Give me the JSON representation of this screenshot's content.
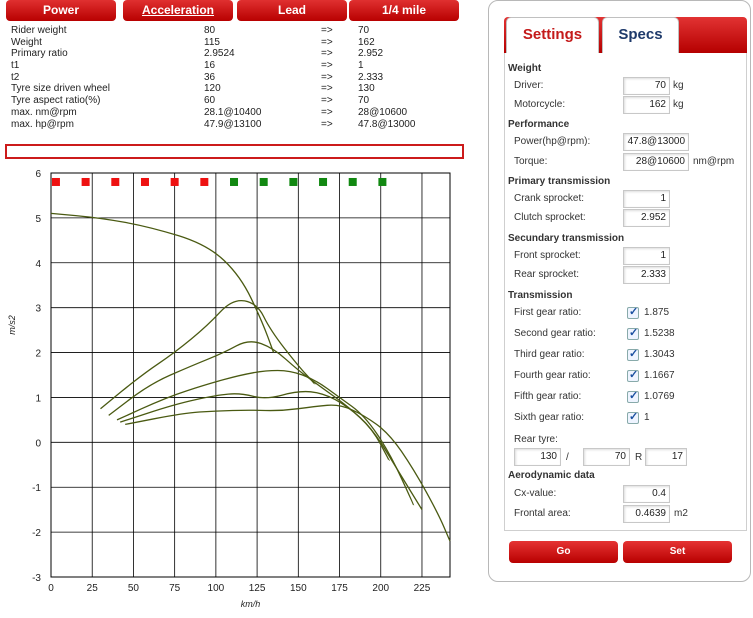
{
  "tabs": [
    {
      "label": "Power"
    },
    {
      "label": "Acceleration"
    },
    {
      "label": "Lead"
    },
    {
      "label": "1/4 mile"
    }
  ],
  "comparison": [
    {
      "label": "Rider weight",
      "v1": "80",
      "arrow": "=>",
      "v2": "70"
    },
    {
      "label": "Weight",
      "v1": "115",
      "arrow": "=>",
      "v2": "162"
    },
    {
      "label": "Primary ratio",
      "v1": "2.9524",
      "arrow": "=>",
      "v2": "2.952"
    },
    {
      "label": "t1",
      "v1": "16",
      "arrow": "=>",
      "v2": "1"
    },
    {
      "label": "t2",
      "v1": "36",
      "arrow": "=>",
      "v2": "2.333"
    },
    {
      "label": "Tyre size driven wheel",
      "v1": "120",
      "arrow": "=>",
      "v2": "130"
    },
    {
      "label": "Tyre aspect ratio(%)",
      "v1": "60",
      "arrow": "=>",
      "v2": "70"
    },
    {
      "label": "max. nm@rpm",
      "v1": "28.1@10400",
      "arrow": "=>",
      "v2": "28@10600"
    },
    {
      "label": "max. hp@rpm",
      "v1": "47.9@13100",
      "arrow": "=>",
      "v2": "47.8@13000"
    }
  ],
  "chart_data": {
    "type": "line",
    "xlabel": "km/h",
    "ylabel": "m/s2",
    "xlim": [
      0,
      242
    ],
    "ylim": [
      -3,
      6
    ],
    "x_ticks": [
      0,
      25,
      50,
      75,
      100,
      125,
      150,
      175,
      200,
      225
    ],
    "y_ticks": [
      -3,
      -2,
      -1,
      0,
      1,
      2,
      3,
      4,
      5,
      6
    ],
    "grid": true,
    "markers": [
      {
        "x": 3,
        "y": 5.8,
        "color": "#ee1111"
      },
      {
        "x": 21,
        "y": 5.8,
        "color": "#ee1111"
      },
      {
        "x": 39,
        "y": 5.8,
        "color": "#ee1111"
      },
      {
        "x": 57,
        "y": 5.8,
        "color": "#ee1111"
      },
      {
        "x": 75,
        "y": 5.8,
        "color": "#ee1111"
      },
      {
        "x": 93,
        "y": 5.8,
        "color": "#ee1111"
      },
      {
        "x": 111,
        "y": 5.8,
        "color": "#118811"
      },
      {
        "x": 129,
        "y": 5.8,
        "color": "#118811"
      },
      {
        "x": 147,
        "y": 5.8,
        "color": "#118811"
      },
      {
        "x": 165,
        "y": 5.8,
        "color": "#118811"
      },
      {
        "x": 183,
        "y": 5.8,
        "color": "#118811"
      },
      {
        "x": 201,
        "y": 5.8,
        "color": "#118811"
      }
    ],
    "series": [
      {
        "values": [
          [
            0,
            5.1
          ],
          [
            30,
            5.0
          ],
          [
            60,
            4.8
          ],
          [
            95,
            4.4
          ],
          [
            115,
            3.7
          ],
          [
            128,
            2.7
          ],
          [
            135,
            2.0
          ]
        ]
      },
      {
        "values": [
          [
            30,
            0.75
          ],
          [
            55,
            1.5
          ],
          [
            75,
            2.0
          ],
          [
            95,
            2.6
          ],
          [
            110,
            3.2
          ],
          [
            125,
            3.1
          ],
          [
            133,
            2.5
          ],
          [
            150,
            1.7
          ],
          [
            160,
            1.3
          ]
        ]
      },
      {
        "values": [
          [
            35,
            0.6
          ],
          [
            60,
            1.3
          ],
          [
            85,
            1.7
          ],
          [
            105,
            2.0
          ],
          [
            120,
            2.3
          ],
          [
            135,
            2.1
          ],
          [
            150,
            1.6
          ],
          [
            165,
            1.2
          ],
          [
            180,
            0.8
          ],
          [
            195,
            0.3
          ],
          [
            205,
            -0.4
          ]
        ]
      },
      {
        "values": [
          [
            40,
            0.5
          ],
          [
            70,
            1.0
          ],
          [
            95,
            1.3
          ],
          [
            115,
            1.5
          ],
          [
            130,
            1.6
          ],
          [
            145,
            1.6
          ],
          [
            160,
            1.4
          ],
          [
            175,
            1.0
          ],
          [
            190,
            0.6
          ],
          [
            205,
            -0.2
          ],
          [
            220,
            -1.4
          ]
        ]
      },
      {
        "values": [
          [
            42,
            0.45
          ],
          [
            75,
            0.85
          ],
          [
            100,
            1.05
          ],
          [
            115,
            1.1
          ],
          [
            130,
            0.95
          ],
          [
            150,
            1.15
          ],
          [
            165,
            1.1
          ],
          [
            180,
            0.8
          ],
          [
            195,
            0.3
          ],
          [
            210,
            -0.6
          ],
          [
            225,
            -1.5
          ]
        ]
      },
      {
        "values": [
          [
            45,
            0.4
          ],
          [
            80,
            0.65
          ],
          [
            100,
            0.7
          ],
          [
            120,
            0.72
          ],
          [
            140,
            0.7
          ],
          [
            160,
            0.8
          ],
          [
            175,
            0.85
          ],
          [
            190,
            0.6
          ],
          [
            205,
            0.2
          ],
          [
            220,
            -0.6
          ],
          [
            235,
            -1.6
          ],
          [
            242,
            -2.2
          ]
        ]
      }
    ]
  },
  "panel": {
    "tabs": {
      "settings": "Settings",
      "specs": "Specs"
    },
    "weight": {
      "title": "Weight",
      "driver": {
        "label": "Driver:",
        "value": "70",
        "unit": "kg"
      },
      "motorcycle": {
        "label": "Motorcycle:",
        "value": "162",
        "unit": "kg"
      }
    },
    "performance": {
      "title": "Performance",
      "power": {
        "label": "Power(hp@rpm):",
        "value": "47.8@13000"
      },
      "torque": {
        "label": "Torque:",
        "value": "28@10600",
        "unit": "nm@rpm"
      }
    },
    "primary": {
      "title": "Primary transmission",
      "crank": {
        "label": "Crank sprocket:",
        "value": "1"
      },
      "clutch": {
        "label": "Clutch sprocket:",
        "value": "2.952"
      }
    },
    "secondary": {
      "title": "Secundary transmission",
      "front": {
        "label": "Front sprocket:",
        "value": "1"
      },
      "rear": {
        "label": "Rear sprocket:",
        "value": "2.333"
      }
    },
    "transmission": {
      "title": "Transmission",
      "gears": [
        {
          "label": "First gear ratio:",
          "value": "1.875"
        },
        {
          "label": "Second gear ratio:",
          "value": "1.5238"
        },
        {
          "label": "Third gear ratio:",
          "value": "1.3043"
        },
        {
          "label": "Fourth gear ratio:",
          "value": "1.1667"
        },
        {
          "label": "Fifth gear ratio:",
          "value": "1.0769"
        },
        {
          "label": "Sixth gear ratio:",
          "value": "1"
        }
      ]
    },
    "tyre": {
      "label": "Rear tyre:",
      "width": "130",
      "slash": "/",
      "aspect": "70",
      "r": "R",
      "rim": "17"
    },
    "aero": {
      "title": "Aerodynamic data",
      "cx": {
        "label": "Cx-value:",
        "value": "0.4"
      },
      "frontal": {
        "label": "Frontal area:",
        "value": "0.4639",
        "unit": "m2"
      }
    },
    "buttons": {
      "go": "Go",
      "set": "Set"
    }
  }
}
